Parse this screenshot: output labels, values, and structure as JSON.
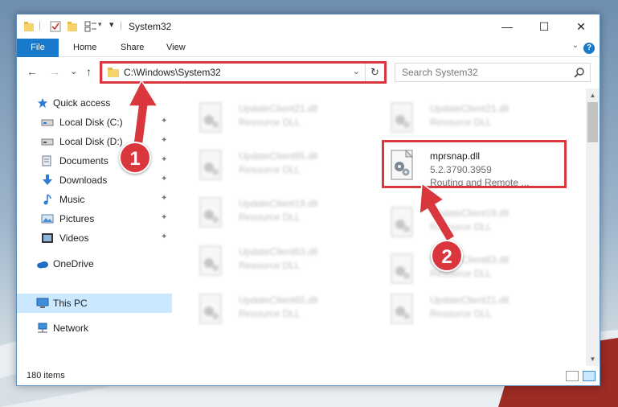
{
  "window": {
    "title": "System32",
    "minimize_glyph": "—",
    "maximize_glyph": "☐",
    "close_glyph": "✕"
  },
  "ribbon": {
    "tabs": [
      {
        "label": "File"
      },
      {
        "label": "Home"
      },
      {
        "label": "Share"
      },
      {
        "label": "View"
      }
    ],
    "help_glyph": "?",
    "collapse_glyph": "⌄"
  },
  "navbar": {
    "back_glyph": "←",
    "forward_glyph": "→",
    "recent_glyph": "⌄",
    "up_glyph": "↑",
    "address": "C:\\Windows\\System32",
    "address_dropdown_glyph": "⌄",
    "refresh_glyph": "↻",
    "search_placeholder": "Search System32"
  },
  "sidebar": {
    "items": [
      {
        "label": "Quick access",
        "icon": "star-icon",
        "pinned": false
      },
      {
        "label": "Local Disk (C:)",
        "icon": "drive-icon",
        "pinned": true
      },
      {
        "label": "Local Disk (D:)",
        "icon": "drive-icon",
        "pinned": true
      },
      {
        "label": "Documents",
        "icon": "documents-icon",
        "pinned": true
      },
      {
        "label": "Downloads",
        "icon": "download-icon",
        "pinned": true
      },
      {
        "label": "Music",
        "icon": "music-icon",
        "pinned": true
      },
      {
        "label": "Pictures",
        "icon": "pictures-icon",
        "pinned": true
      },
      {
        "label": "Videos",
        "icon": "videos-icon",
        "pinned": true
      },
      {
        "label": "OneDrive",
        "icon": "cloud-icon",
        "pinned": false
      },
      {
        "label": "This PC",
        "icon": "computer-icon",
        "pinned": false,
        "selected": true
      },
      {
        "label": "Network",
        "icon": "network-icon",
        "pinned": false
      }
    ],
    "pin_glyph": "📌"
  },
  "files": [
    {
      "name": "UpdateClient21.dll",
      "type": "Resource DLL"
    },
    {
      "name": "UpdateClient21.dll",
      "type": "Resource DLL"
    },
    {
      "name": "UpdateClient65.dll",
      "type": "Resource DLL"
    },
    {
      "name": "UpdateClient19.dll",
      "type": "Resource DLL"
    },
    {
      "name": "UpdateClient19.dll",
      "type": "Resource DLL"
    },
    {
      "name": "UpdateClient63.dll",
      "type": "Resource DLL"
    },
    {
      "name": "UpdateClient63.dll",
      "type": "Resource DLL"
    },
    {
      "name": "UpdateClient65.dll",
      "type": "Resource DLL"
    },
    {
      "name": "UpdateClient21.dll",
      "type": "Resource DLL"
    }
  ],
  "highlighted_file": {
    "name": "mprsnap.dll",
    "version": "5.2.3790.3959",
    "description": "Routing and Remote ..."
  },
  "scrollbar": {
    "up_glyph": "▲",
    "down_glyph": "▼"
  },
  "status": {
    "item_count": "180 items"
  },
  "annotations": [
    {
      "number": "1"
    },
    {
      "number": "2"
    }
  ],
  "colors": {
    "accent": "#1979ca",
    "highlight_red": "#d9363e",
    "selection": "#cce8ff"
  }
}
